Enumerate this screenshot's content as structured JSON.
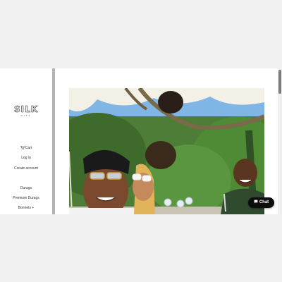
{
  "brand": {
    "logo_text": "SILK",
    "logo_sub": "CITY"
  },
  "nav": {
    "cart": "Cart",
    "login": "Log in",
    "create_account": "Create account",
    "durags": "Durags",
    "premium_durags": "Premium Durags",
    "bonnets": "Bonnets +"
  },
  "photo": {
    "alt": ""
  },
  "chat": {
    "label": "Chat"
  },
  "icons": {
    "cart": "cart-icon",
    "chat": "chat-bubble-icon"
  },
  "colors": {
    "accent": "#0d0d0d",
    "sky": "#7fb6e6",
    "foliage": "#3e6b2c",
    "canopy": "#f3f0e6"
  }
}
